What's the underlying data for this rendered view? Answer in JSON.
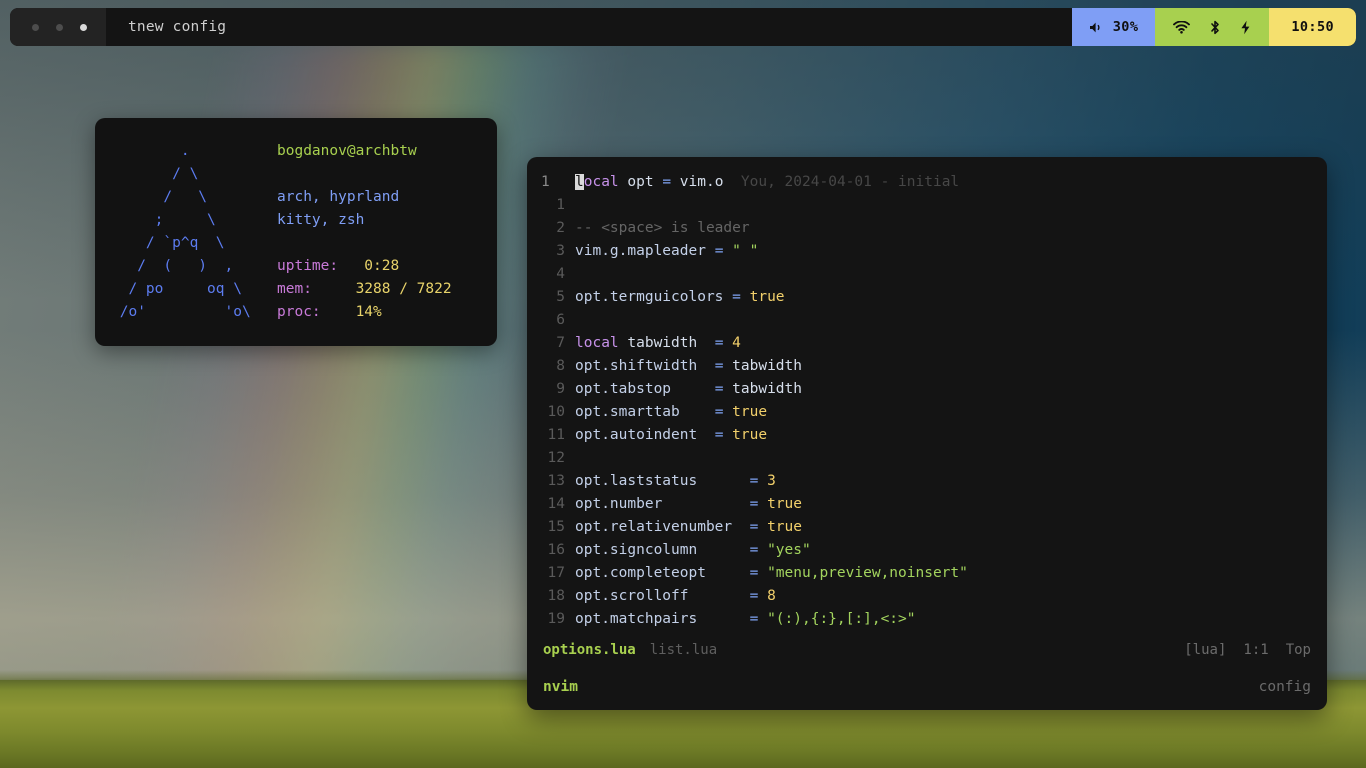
{
  "topbar": {
    "window_dots": [
      "dot-1",
      "dot-2",
      "dot-3"
    ],
    "title": "tnew config",
    "volume": {
      "icon": "speaker-icon",
      "label": "30%",
      "color": "#7f9ef5"
    },
    "system": {
      "color": "#a8d04f",
      "icons": [
        "wifi-icon",
        "bluetooth-icon",
        "charging-bolt-icon"
      ]
    },
    "clock": {
      "label": "10:50",
      "color": "#f5e06e"
    }
  },
  "fetch": {
    "ascii_art": [
      "        .        ",
      "       / \\       ",
      "      /   \\      ",
      "     ;     \\     ",
      "    / `p^q  \\    ",
      "   /  (   )  ,   ",
      "  / po     oq \\  ",
      " /o'         'o\\ "
    ],
    "user_host": "bogdanov@archbtw",
    "os_wm": "arch, hyprland",
    "term_shell": "kitty, zsh",
    "rows": [
      {
        "key": "uptime:",
        "value": "0:28"
      },
      {
        "key": "mem:",
        "value": "3288 / 7822"
      },
      {
        "key": "proc:",
        "value": "14%"
      }
    ],
    "colors": {
      "art": "#5c7cf0",
      "user": "#a8d04f",
      "info": "#7f9ef5",
      "key": "#c87ad8",
      "value": "#e8d36a"
    }
  },
  "editor": {
    "lines": [
      {
        "num": "1",
        "cursorline": true,
        "blame": "You, 2024-04-01 - initial",
        "tokens": [
          {
            "t": "l",
            "c": "cursor"
          },
          {
            "t": "ocal",
            "c": "kw"
          },
          {
            "t": " ",
            "c": "plain"
          },
          {
            "t": "opt",
            "c": "ident"
          },
          {
            "t": " ",
            "c": "plain"
          },
          {
            "t": "=",
            "c": "op"
          },
          {
            "t": " ",
            "c": "plain"
          },
          {
            "t": "vim.o",
            "c": "plain"
          }
        ]
      },
      {
        "num": "1",
        "tokens": []
      },
      {
        "num": "2",
        "tokens": [
          {
            "t": "-- <space> is leader",
            "c": "comment"
          }
        ]
      },
      {
        "num": "3",
        "tokens": [
          {
            "t": "vim.g.mapleader",
            "c": "prop"
          },
          {
            "t": " ",
            "c": "plain"
          },
          {
            "t": "=",
            "c": "op"
          },
          {
            "t": " ",
            "c": "plain"
          },
          {
            "t": "\" \"",
            "c": "str"
          }
        ]
      },
      {
        "num": "4",
        "tokens": []
      },
      {
        "num": "5",
        "tokens": [
          {
            "t": "opt.termguicolors",
            "c": "prop"
          },
          {
            "t": " ",
            "c": "plain"
          },
          {
            "t": "=",
            "c": "op"
          },
          {
            "t": " ",
            "c": "plain"
          },
          {
            "t": "true",
            "c": "bool"
          }
        ]
      },
      {
        "num": "6",
        "tokens": []
      },
      {
        "num": "7",
        "tokens": [
          {
            "t": "local",
            "c": "kw"
          },
          {
            "t": " ",
            "c": "plain"
          },
          {
            "t": "tabwidth",
            "c": "ident"
          },
          {
            "t": "  ",
            "c": "plain"
          },
          {
            "t": "=",
            "c": "op"
          },
          {
            "t": " ",
            "c": "plain"
          },
          {
            "t": "4",
            "c": "num"
          }
        ]
      },
      {
        "num": "8",
        "tokens": [
          {
            "t": "opt.shiftwidth",
            "c": "prop"
          },
          {
            "t": "  ",
            "c": "plain"
          },
          {
            "t": "=",
            "c": "op"
          },
          {
            "t": " ",
            "c": "plain"
          },
          {
            "t": "tabwidth",
            "c": "ident"
          }
        ]
      },
      {
        "num": "9",
        "tokens": [
          {
            "t": "opt.tabstop",
            "c": "prop"
          },
          {
            "t": "     ",
            "c": "plain"
          },
          {
            "t": "=",
            "c": "op"
          },
          {
            "t": " ",
            "c": "plain"
          },
          {
            "t": "tabwidth",
            "c": "ident"
          }
        ]
      },
      {
        "num": "10",
        "tokens": [
          {
            "t": "opt.smarttab",
            "c": "prop"
          },
          {
            "t": "    ",
            "c": "plain"
          },
          {
            "t": "=",
            "c": "op"
          },
          {
            "t": " ",
            "c": "plain"
          },
          {
            "t": "true",
            "c": "bool"
          }
        ]
      },
      {
        "num": "11",
        "tokens": [
          {
            "t": "opt.autoindent",
            "c": "prop"
          },
          {
            "t": "  ",
            "c": "plain"
          },
          {
            "t": "=",
            "c": "op"
          },
          {
            "t": " ",
            "c": "plain"
          },
          {
            "t": "true",
            "c": "bool"
          }
        ]
      },
      {
        "num": "12",
        "tokens": []
      },
      {
        "num": "13",
        "tokens": [
          {
            "t": "opt.laststatus",
            "c": "prop"
          },
          {
            "t": "      ",
            "c": "plain"
          },
          {
            "t": "=",
            "c": "op"
          },
          {
            "t": " ",
            "c": "plain"
          },
          {
            "t": "3",
            "c": "num"
          }
        ]
      },
      {
        "num": "14",
        "tokens": [
          {
            "t": "opt.number",
            "c": "prop"
          },
          {
            "t": "          ",
            "c": "plain"
          },
          {
            "t": "=",
            "c": "op"
          },
          {
            "t": " ",
            "c": "plain"
          },
          {
            "t": "true",
            "c": "bool"
          }
        ]
      },
      {
        "num": "15",
        "tokens": [
          {
            "t": "opt.relativenumber",
            "c": "prop"
          },
          {
            "t": "  ",
            "c": "plain"
          },
          {
            "t": "=",
            "c": "op"
          },
          {
            "t": " ",
            "c": "plain"
          },
          {
            "t": "true",
            "c": "bool"
          }
        ]
      },
      {
        "num": "16",
        "tokens": [
          {
            "t": "opt.signcolumn",
            "c": "prop"
          },
          {
            "t": "      ",
            "c": "plain"
          },
          {
            "t": "=",
            "c": "op"
          },
          {
            "t": " ",
            "c": "plain"
          },
          {
            "t": "\"yes\"",
            "c": "str"
          }
        ]
      },
      {
        "num": "17",
        "tokens": [
          {
            "t": "opt.completeopt",
            "c": "prop"
          },
          {
            "t": "     ",
            "c": "plain"
          },
          {
            "t": "=",
            "c": "op"
          },
          {
            "t": " ",
            "c": "plain"
          },
          {
            "t": "\"menu,preview,noinsert\"",
            "c": "str"
          }
        ]
      },
      {
        "num": "18",
        "tokens": [
          {
            "t": "opt.scrolloff",
            "c": "prop"
          },
          {
            "t": "       ",
            "c": "plain"
          },
          {
            "t": "=",
            "c": "op"
          },
          {
            "t": " ",
            "c": "plain"
          },
          {
            "t": "8",
            "c": "num"
          }
        ]
      },
      {
        "num": "19",
        "tokens": [
          {
            "t": "opt.matchpairs",
            "c": "prop"
          },
          {
            "t": "      ",
            "c": "plain"
          },
          {
            "t": "=",
            "c": "op"
          },
          {
            "t": " ",
            "c": "plain"
          },
          {
            "t": "\"(:),{:},[:],<:>\"",
            "c": "str"
          }
        ]
      }
    ],
    "statusline": {
      "buffers": [
        {
          "label": "options.lua",
          "active": true
        },
        {
          "label": "list.lua",
          "active": false
        }
      ],
      "filetype": "[lua]",
      "position": "1:1",
      "scroll": "Top"
    },
    "tmuxline": {
      "session_left": "nvim",
      "session_right": "config"
    }
  }
}
